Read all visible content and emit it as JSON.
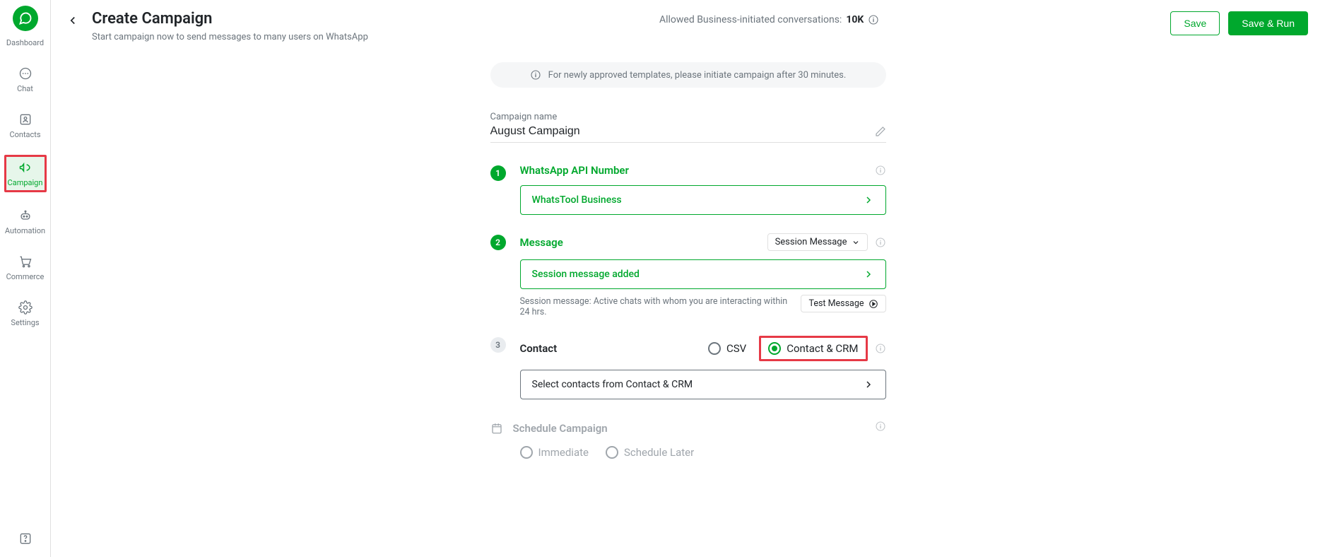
{
  "sidebar": {
    "items": [
      {
        "label": "Dashboard"
      },
      {
        "label": "Chat"
      },
      {
        "label": "Contacts"
      },
      {
        "label": "Campaign"
      },
      {
        "label": "Automation"
      },
      {
        "label": "Commerce"
      },
      {
        "label": "Settings"
      }
    ]
  },
  "header": {
    "title": "Create Campaign",
    "subtitle": "Start campaign now to send messages to many users on WhatsApp",
    "allowed_prefix": "Allowed Business-initiated conversations: ",
    "allowed_value": "10K",
    "save_label": "Save",
    "save_run_label": "Save & Run"
  },
  "banner": {
    "text": "For newly approved templates, please initiate campaign after 30 minutes."
  },
  "campaign_name": {
    "label": "Campaign name",
    "value": "August Campaign"
  },
  "steps": {
    "api_number": {
      "num": "1",
      "title": "WhatsApp API Number",
      "selected": "WhatsTool Business"
    },
    "message": {
      "num": "2",
      "title": "Message",
      "type_label": "Session Message",
      "selected": "Session message added",
      "hint": "Session message: Active chats with whom you are interacting within 24 hrs.",
      "test_label": "Test Message"
    },
    "contact": {
      "num": "3",
      "title": "Contact",
      "option_csv": "CSV",
      "option_crm": "Contact & CRM",
      "select_placeholder": "Select contacts from Contact & CRM"
    },
    "schedule": {
      "title": "Schedule Campaign",
      "immediate": "Immediate",
      "later": "Schedule Later"
    }
  }
}
